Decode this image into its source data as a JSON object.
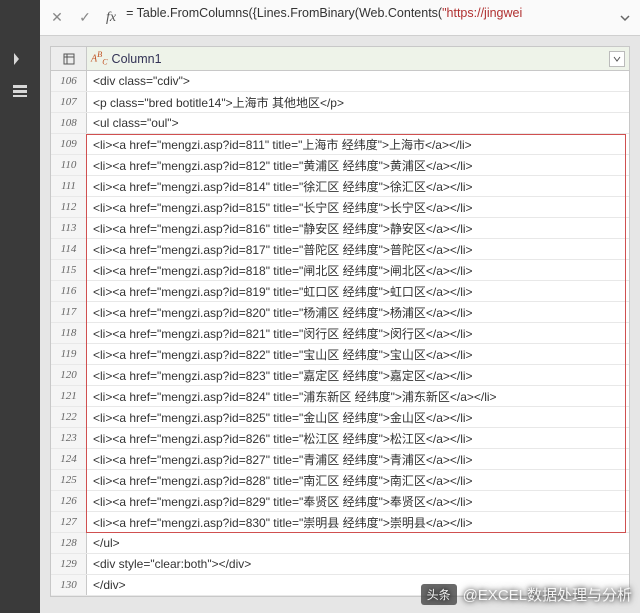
{
  "formula_bar": {
    "prefix": "= Table.FromColumns({Lines.FromBinary(Web.Contents(",
    "url_fragment": "\"https://jingwei"
  },
  "column": {
    "type_label": "ABC123",
    "name": "Column1"
  },
  "rows": [
    {
      "n": 106,
      "text": "<div class=\"cdiv\">",
      "hl": false
    },
    {
      "n": 107,
      "text": "<p class=\"bred botitle14\">上海市 其他地区</p>",
      "hl": false
    },
    {
      "n": 108,
      "text": "<ul class=\"oul\">",
      "hl": false
    },
    {
      "n": 109,
      "text": "<li><a href=\"mengzi.asp?id=811\" title=\"上海市 经纬度\">上海市</a></li>",
      "hl": true
    },
    {
      "n": 110,
      "text": "<li><a href=\"mengzi.asp?id=812\" title=\"黄浦区 经纬度\">黄浦区</a></li>",
      "hl": true
    },
    {
      "n": 111,
      "text": "<li><a href=\"mengzi.asp?id=814\" title=\"徐汇区 经纬度\">徐汇区</a></li>",
      "hl": true
    },
    {
      "n": 112,
      "text": "<li><a href=\"mengzi.asp?id=815\" title=\"长宁区 经纬度\">长宁区</a></li>",
      "hl": true
    },
    {
      "n": 113,
      "text": "<li><a href=\"mengzi.asp?id=816\" title=\"静安区 经纬度\">静安区</a></li>",
      "hl": true
    },
    {
      "n": 114,
      "text": "<li><a href=\"mengzi.asp?id=817\" title=\"普陀区 经纬度\">普陀区</a></li>",
      "hl": true
    },
    {
      "n": 115,
      "text": "<li><a href=\"mengzi.asp?id=818\" title=\"闸北区 经纬度\">闸北区</a></li>",
      "hl": true
    },
    {
      "n": 116,
      "text": "<li><a href=\"mengzi.asp?id=819\" title=\"虹口区 经纬度\">虹口区</a></li>",
      "hl": true
    },
    {
      "n": 117,
      "text": "<li><a href=\"mengzi.asp?id=820\" title=\"杨浦区 经纬度\">杨浦区</a></li>",
      "hl": true
    },
    {
      "n": 118,
      "text": "<li><a href=\"mengzi.asp?id=821\" title=\"闵行区 经纬度\">闵行区</a></li>",
      "hl": true
    },
    {
      "n": 119,
      "text": "<li><a href=\"mengzi.asp?id=822\" title=\"宝山区 经纬度\">宝山区</a></li>",
      "hl": true
    },
    {
      "n": 120,
      "text": "<li><a href=\"mengzi.asp?id=823\" title=\"嘉定区 经纬度\">嘉定区</a></li>",
      "hl": true
    },
    {
      "n": 121,
      "text": "<li><a href=\"mengzi.asp?id=824\" title=\"浦东新区 经纬度\">浦东新区</a></li>",
      "hl": true
    },
    {
      "n": 122,
      "text": "<li><a href=\"mengzi.asp?id=825\" title=\"金山区 经纬度\">金山区</a></li>",
      "hl": true
    },
    {
      "n": 123,
      "text": "<li><a href=\"mengzi.asp?id=826\" title=\"松江区 经纬度\">松江区</a></li>",
      "hl": true
    },
    {
      "n": 124,
      "text": "<li><a href=\"mengzi.asp?id=827\" title=\"青浦区 经纬度\">青浦区</a></li>",
      "hl": true
    },
    {
      "n": 125,
      "text": "<li><a href=\"mengzi.asp?id=828\" title=\"南汇区 经纬度\">南汇区</a></li>",
      "hl": true
    },
    {
      "n": 126,
      "text": "<li><a href=\"mengzi.asp?id=829\" title=\"奉贤区 经纬度\">奉贤区</a></li>",
      "hl": true
    },
    {
      "n": 127,
      "text": "<li><a href=\"mengzi.asp?id=830\" title=\"崇明县 经纬度\">崇明县</a></li>",
      "hl": true
    },
    {
      "n": 128,
      "text": "</ul>",
      "hl": false
    },
    {
      "n": 129,
      "text": "<div style=\"clear:both\"></div>",
      "hl": false
    },
    {
      "n": 130,
      "text": "</div>",
      "hl": false
    }
  ],
  "watermark": {
    "prefix": "头条",
    "name": "@EXCEL数据处理与分析"
  }
}
